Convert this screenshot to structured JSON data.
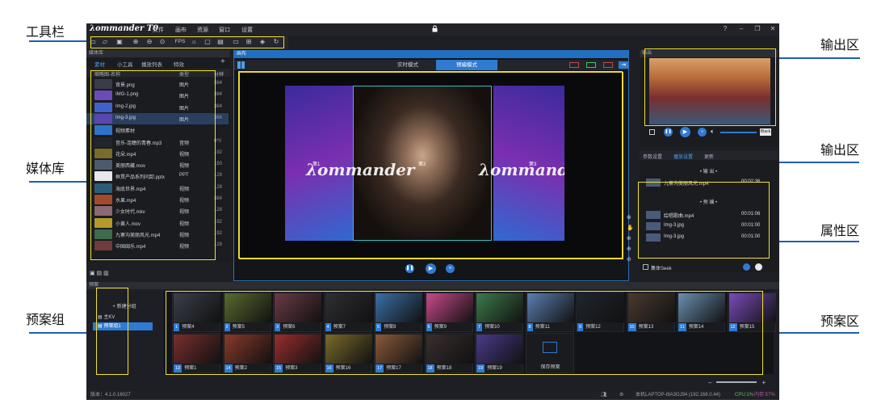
{
  "annotations": {
    "toolbar": "工具栏",
    "medialib": "媒体库",
    "presetgroup": "预案组",
    "output1": "输出区",
    "output2": "输出区",
    "props": "属性区",
    "presetarea": "预案区"
  },
  "app": {
    "logo": "λommander T0",
    "menu": [
      "文件",
      "画布",
      "资源",
      "窗口",
      "设置"
    ]
  },
  "toolbar": {
    "fps": "FPS",
    "icons": [
      "folder-new-icon",
      "folder-open-icon",
      "save-icon",
      "zoom-in-icon",
      "zoom-out-icon",
      "target-icon",
      "settings-icon",
      "screen-icon",
      "display-icon",
      "folder-icon",
      "network-icon",
      "layers-icon",
      "refresh-icon"
    ]
  },
  "media": {
    "title": "媒体库",
    "tabs": [
      "素材",
      "小工具",
      "播放列表",
      "特效"
    ],
    "headers": [
      "缩略图-名称",
      "类型",
      "分辨"
    ],
    "items": [
      {
        "name": "背景.png",
        "type": "图片",
        "size": "384",
        "color": "#3a3d47"
      },
      {
        "name": "IMG-1.png",
        "type": "图片",
        "size": "384",
        "color": "#6b4bb8"
      },
      {
        "name": "Img-2.jpg",
        "type": "图片",
        "size": "384",
        "color": "#3f61c9"
      },
      {
        "name": "Img-3.jpg",
        "type": "图片",
        "size": "384",
        "color": "#5a46b0"
      },
      {
        "name": "视频素材",
        "type": "",
        "size": "",
        "color": "#2d74c8"
      },
      {
        "name": "音乐-连睫的青春.mp3",
        "type": "音频",
        "size": "0*0",
        "color": "#22252b"
      },
      {
        "name": "花朵.mp4",
        "type": "视频",
        "size": "192",
        "color": "#7a6b2a"
      },
      {
        "name": "美丽西藏.mov",
        "type": "视频",
        "size": "150",
        "color": "#4c5a6e"
      },
      {
        "name": "框贯产品系列问卸.pptx",
        "type": "PPT",
        "size": "128",
        "color": "#e8e8ea"
      },
      {
        "name": "海底世界.mp4",
        "type": "视频",
        "size": "128",
        "color": "#2c5d78"
      },
      {
        "name": "水果.mp4",
        "type": "视频",
        "size": "384",
        "color": "#a44a2c"
      },
      {
        "name": "少女时代.mkv",
        "type": "视频",
        "size": "128",
        "color": "#8a6a73"
      },
      {
        "name": "小黄人.mov",
        "type": "视频",
        "size": "192",
        "color": "#b59a2b"
      },
      {
        "name": "九寨沟美丽风光.mp4",
        "type": "视频",
        "size": "192",
        "color": "#3f6a4d"
      },
      {
        "name": "中国闽乐.mp4",
        "type": "视频",
        "size": "128",
        "color": "#6f3b3b"
      }
    ]
  },
  "canvas": {
    "title": "画布",
    "modes": [
      "实时模式",
      "预编模式"
    ],
    "scene_labels": [
      "第1",
      "第2",
      "第3"
    ],
    "brand": "λommander"
  },
  "output": {
    "title": "输出",
    "tabs": [
      "参数设置",
      "播放设置",
      "更新"
    ]
  },
  "props": {
    "section1": "• 输 出 •",
    "section2": "• 预 编 •",
    "out_rows": [
      {
        "name": "九寨沟美丽风光.mp4",
        "time": "00:02:36"
      }
    ],
    "pre_rows": [
      {
        "name": "绘唱歌曲.mp4",
        "time": "00:01:06"
      },
      {
        "name": "Img-3.jpg",
        "time": "00:01:00"
      },
      {
        "name": "Img-3.jpg",
        "time": "00:01:00"
      }
    ],
    "seek": "集体Seek"
  },
  "presets": {
    "title": "预案",
    "new_group": "新建分组",
    "kv": "主KV",
    "group1": "预案组1",
    "save": "保存预案",
    "row1": [
      {
        "n": "1",
        "l": "预案4",
        "c": "#3b3f4a"
      },
      {
        "n": "2",
        "l": "预案5",
        "c": "#5a6b2f"
      },
      {
        "n": "3",
        "l": "预案6",
        "c": "#6a3a44"
      },
      {
        "n": "4",
        "l": "预案7",
        "c": "#2e2f33"
      },
      {
        "n": "5",
        "l": "预案8",
        "c": "#3b6fa8"
      },
      {
        "n": "6",
        "l": "预案9",
        "c": "#c84a8a"
      },
      {
        "n": "7",
        "l": "预案10",
        "c": "#3d7a4a"
      },
      {
        "n": "8",
        "l": "预案11",
        "c": "#5a7fb2"
      },
      {
        "n": "9",
        "l": "预案12",
        "c": "#20252f"
      },
      {
        "n": "10",
        "l": "预案13",
        "c": "#4a3a2e"
      },
      {
        "n": "11",
        "l": "预案14",
        "c": "#6a8fb0"
      },
      {
        "n": "12",
        "l": "预案15",
        "c": "#7a4bb8"
      }
    ],
    "row2": [
      {
        "n": "13",
        "l": "预案1",
        "c": "#7a2e2e"
      },
      {
        "n": "14",
        "l": "预案2",
        "c": "#8a3a2a"
      },
      {
        "n": "15",
        "l": "预案3",
        "c": "#9a2e2e"
      },
      {
        "n": "16",
        "l": "预案16",
        "c": "#7a6a2a"
      },
      {
        "n": "17",
        "l": "预案17",
        "c": "#8a5a3a"
      },
      {
        "n": "18",
        "l": "预案18",
        "c": "#3a2e2e"
      },
      {
        "n": "19",
        "l": "预案19",
        "c": "#4a3a8a"
      }
    ]
  },
  "status": {
    "version": "版本：4.1.0.16027",
    "host": "本机LAPTOP-I9A3OJ94 (192.168.0.44)",
    "cpu": "CPU:1%",
    "mem": "内存:57%"
  }
}
